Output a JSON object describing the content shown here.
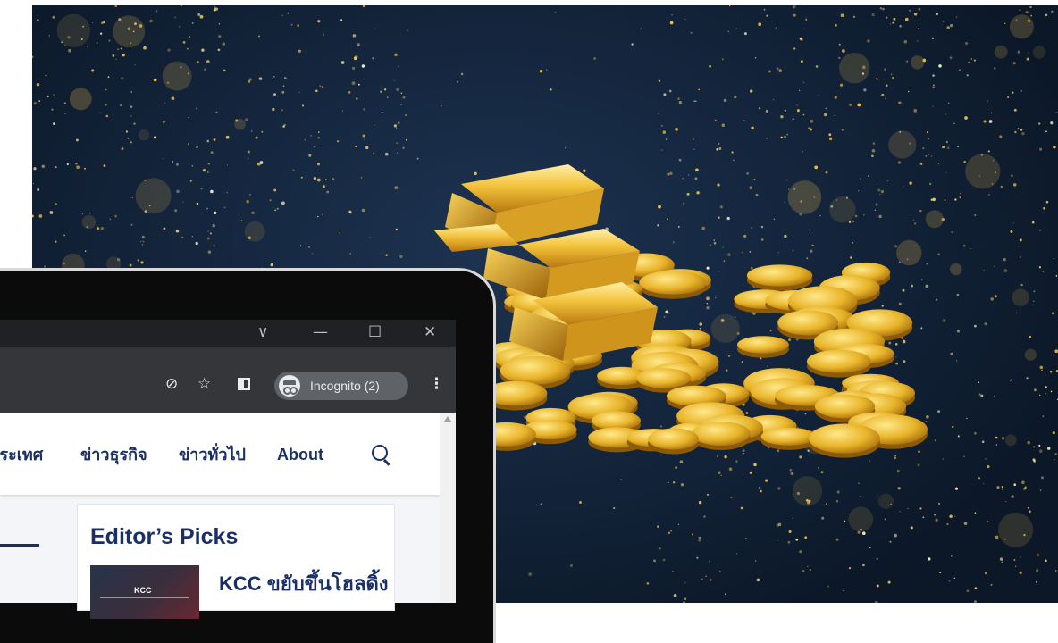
{
  "browser": {
    "window_controls": {
      "dropdown": "∨",
      "minimize": "—",
      "maximize": "☐",
      "close": "✕"
    },
    "toolbar": {
      "incognito_label": "Incognito (2)",
      "menu_icon": "⋮",
      "star_icon": "☆",
      "eye_off_icon": "⊘"
    }
  },
  "site": {
    "nav": [
      {
        "label": "ประเทศ"
      },
      {
        "label": "ข่าวธุรกิจ"
      },
      {
        "label": "ข่าวทั่วไป"
      },
      {
        "label": "About"
      }
    ],
    "editors_picks": {
      "title": "Editor’s Picks",
      "thumb_label": "KCC",
      "headline": "KCC ขยับขึ้นโฮลดิ้ง"
    }
  },
  "colors": {
    "nav_text": "#1a2f66",
    "hero_bg": "#13243b",
    "gold": "#d9a521",
    "chrome_dark": "#202124",
    "chrome_toolbar": "#35363a"
  }
}
